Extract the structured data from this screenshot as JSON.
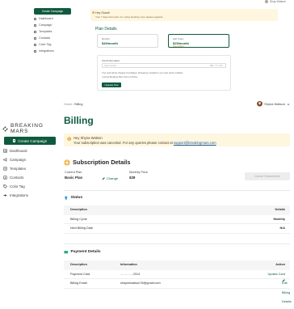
{
  "background_screen": {
    "create_label": "Create Campaign",
    "nav": [
      "Dashboard",
      "Campaign",
      "Templates",
      "Contacts",
      "Color Tag",
      "Integrations"
    ],
    "user": "Shay Watson",
    "alert_title": "Hey Stuart!",
    "alert_text": "Your 7 days trial ends. For using booking more please upgrade.",
    "modal_title": "Plan Details",
    "plans": [
      {
        "period": "Monthly",
        "price": "$49/month",
        "note": ""
      },
      {
        "period": "Half Yearly",
        "price": "$29/month",
        "note": "Save $240/yr"
      }
    ],
    "card_info_label": "Card Information",
    "card_placeholder": "Card number",
    "card_suffix": "MM / YY  CVC",
    "terms_1": "Your card will be charged immediately. All features included in your plan will be enabled.",
    "terms_2": "I accept Breaking Mars Terms & Policy",
    "pay_button": "Upgrade Now"
  },
  "sidebar": {
    "brand": "BREAKING MARS",
    "create_label": "Create Campaign",
    "items": [
      {
        "label": "Dashboard",
        "icon": "dashboard-icon"
      },
      {
        "label": "Campaign",
        "icon": "campaign-icon"
      },
      {
        "label": "Templates",
        "icon": "templates-icon"
      },
      {
        "label": "Contacts",
        "icon": "contacts-icon"
      },
      {
        "label": "Color Tag",
        "icon": "tag-icon"
      },
      {
        "label": "Integrations",
        "icon": "integrations-icon"
      }
    ]
  },
  "header": {
    "breadcrumb_home": "Home",
    "breadcrumb_sep": "/",
    "breadcrumb_current": "Billing",
    "user_name": "Shyna Watson"
  },
  "page": {
    "title": "Billing",
    "alert_greeting": "Hey Shyna Watson",
    "alert_message": "Your subscription was canceled. For any queries please contact at ",
    "alert_email": "support@breakingmars.com",
    "subscription_title": "Subscription Details",
    "current_plan_label": "Current Plan",
    "current_plan_value": "Basic Plan",
    "change_label": "Change",
    "monthly_price_label": "Monthly Price",
    "monthly_price_value": "$29",
    "cancel_label": "Cancel Subscription",
    "status_title": "Status",
    "status_table": {
      "headers": [
        "Description",
        "Details"
      ],
      "rows": [
        [
          "Billing Cycle",
          "Monthly"
        ],
        [
          "Next Billing Date",
          "N/A"
        ]
      ]
    },
    "payment_title": "Payment Details",
    "payment_table": {
      "headers": [
        "Description",
        "Information",
        "Action"
      ],
      "rows": [
        {
          "desc": "Payment Card",
          "info": ".... .... .... 2314",
          "action": "Update Card"
        },
        {
          "desc": "Billing Email",
          "info": "shaynewatson78@gmail.com",
          "action": "Edit Billing Details"
        }
      ]
    }
  },
  "colors": {
    "brand_green": "#0f5a3e",
    "alert_bg": "#fff6df",
    "link_blue": "#1b5fa8"
  }
}
